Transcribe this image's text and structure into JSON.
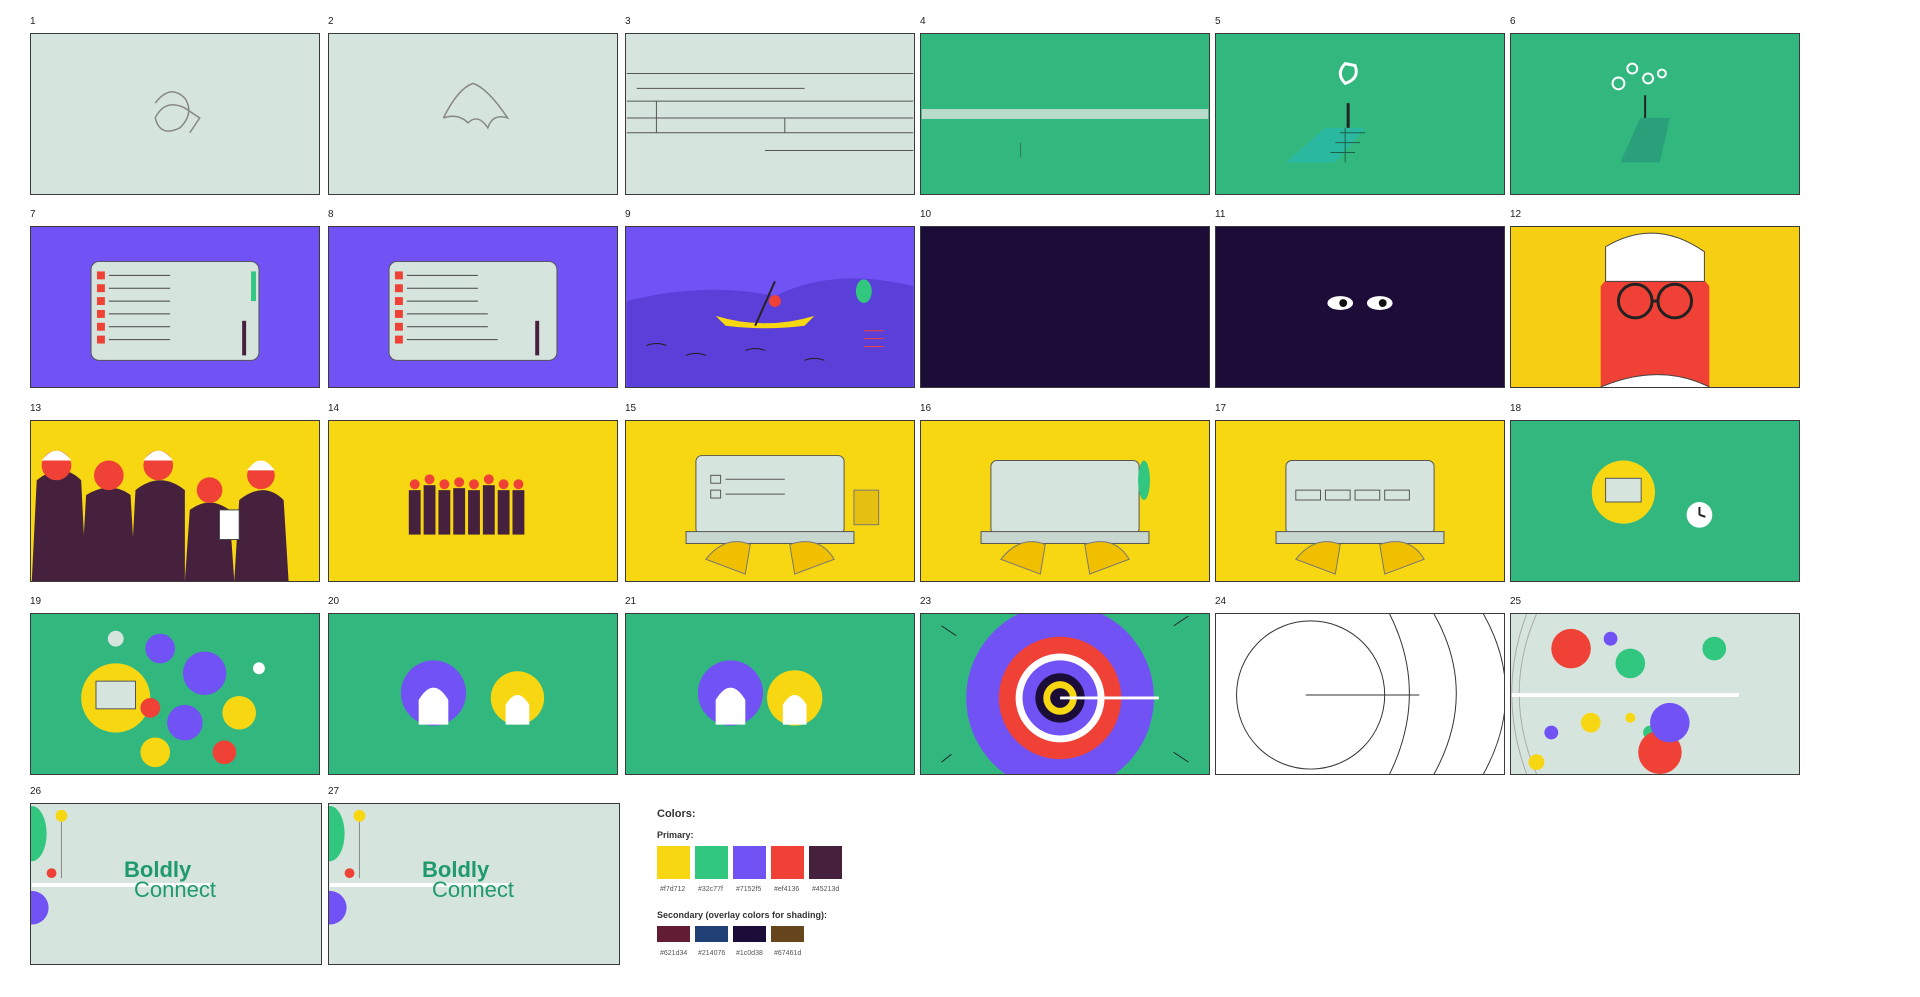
{
  "frames": [
    {
      "n": "1"
    },
    {
      "n": "2"
    },
    {
      "n": "3"
    },
    {
      "n": "4"
    },
    {
      "n": "5"
    },
    {
      "n": "6"
    },
    {
      "n": "7"
    },
    {
      "n": "8"
    },
    {
      "n": "9"
    },
    {
      "n": "10"
    },
    {
      "n": "11"
    },
    {
      "n": "12"
    },
    {
      "n": "13"
    },
    {
      "n": "14"
    },
    {
      "n": "15"
    },
    {
      "n": "16"
    },
    {
      "n": "17"
    },
    {
      "n": "18"
    },
    {
      "n": "19"
    },
    {
      "n": "20"
    },
    {
      "n": "21"
    },
    {
      "n": "23"
    },
    {
      "n": "24"
    },
    {
      "n": "25"
    },
    {
      "n": "26"
    },
    {
      "n": "27"
    }
  ],
  "logo": {
    "line1": "Boldly",
    "line2": "Connect"
  },
  "colors": {
    "title": "Colors:",
    "primary_label": "Primary:",
    "primary": [
      {
        "hex": "#f7d712",
        "label": "#f7d712"
      },
      {
        "hex": "#32c77f",
        "label": "#32c77f"
      },
      {
        "hex": "#7152f5",
        "label": "#7152f5"
      },
      {
        "hex": "#ef4136",
        "label": "#ef4136"
      },
      {
        "hex": "#45213d",
        "label": "#45213d"
      }
    ],
    "secondary_label": "Secondary (overlay colors for shading):",
    "secondary": [
      {
        "hex": "#621d34",
        "label": "#621d34"
      },
      {
        "hex": "#214076",
        "label": "#214076"
      },
      {
        "hex": "#1c0d38",
        "label": "#1c0d38"
      },
      {
        "hex": "#67461d",
        "label": "#67461d"
      }
    ]
  }
}
